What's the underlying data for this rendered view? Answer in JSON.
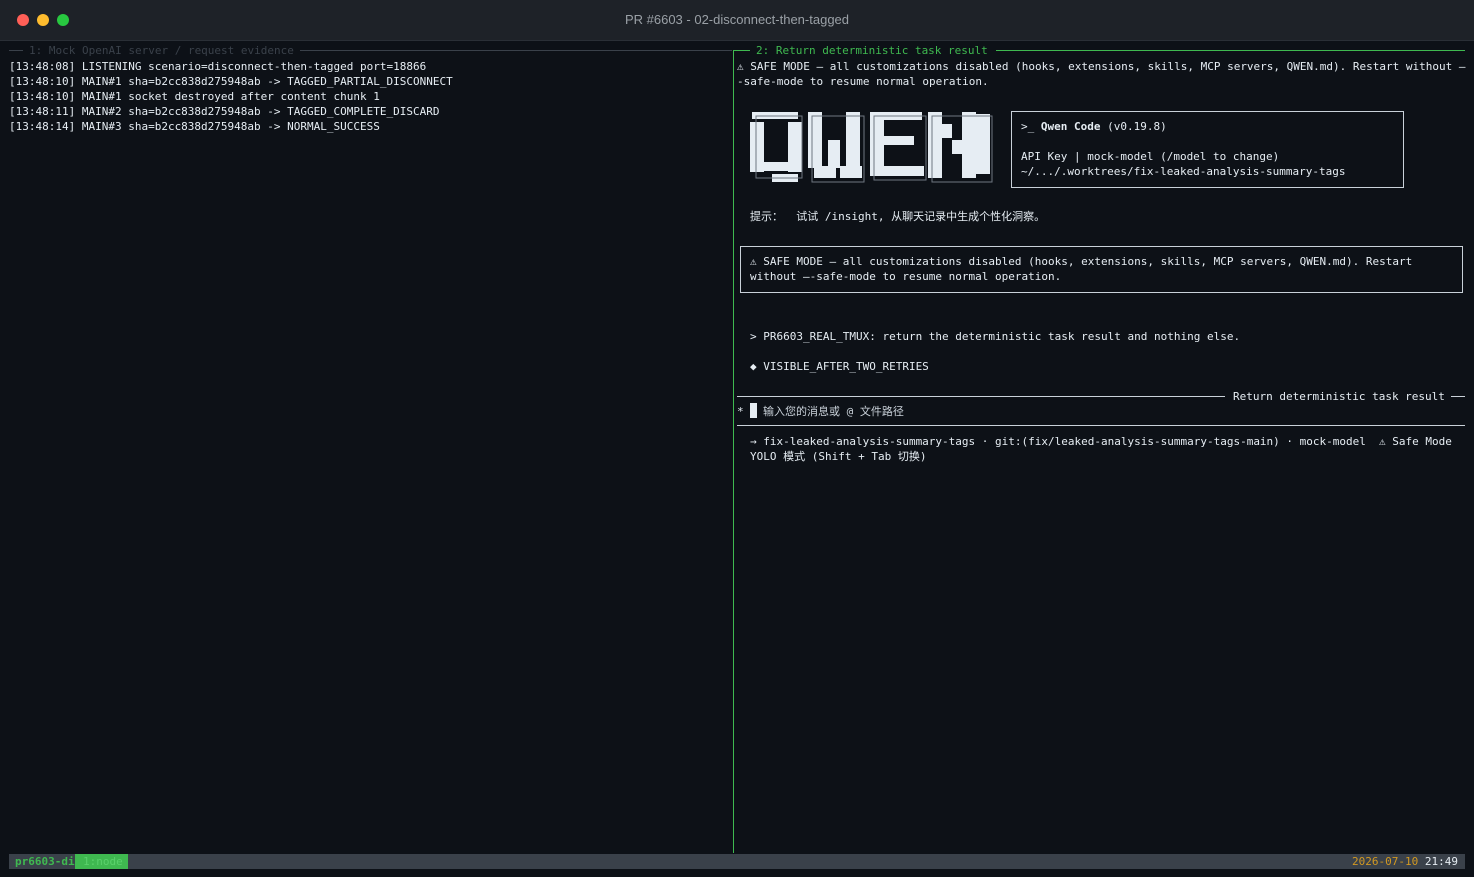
{
  "window": {
    "title": "PR #6603 - 02-disconnect-then-tagged"
  },
  "left_pane": {
    "header": "1: Mock OpenAI server / request evidence",
    "lines": [
      "[13:48:08] LISTENING scenario=disconnect-then-tagged port=18866",
      "[13:48:10] MAIN#1 sha=b2cc838d275948ab -> TAGGED_PARTIAL_DISCONNECT",
      "[13:48:10] MAIN#1 socket destroyed after content chunk 1",
      "[13:48:11] MAIN#2 sha=b2cc838d275948ab -> TAGGED_COMPLETE_DISCARD",
      "[13:48:14] MAIN#3 sha=b2cc838d275948ab -> NORMAL_SUCCESS"
    ]
  },
  "right_pane": {
    "header": "2: Return deterministic task result",
    "warning_line1": "⚠ SAFE MODE — all customizations disabled (hooks, extensions, skills, MCP servers, QWEN.md). Restart without –",
    "warning_line2": "-safe-mode to resume normal operation.",
    "info_box": {
      "prompt": ">_",
      "app_name": "Qwen Code",
      "version": "(v0.19.8)",
      "auth_line": "API Key | mock-model (/model to change)",
      "path": "~/.../.worktrees/fix-leaked-analysis-summary-tags"
    },
    "tip": "提示：  试试 /insight, 从聊天记录中生成个性化洞察。",
    "safe_box_line1": "⚠ SAFE MODE — all customizations disabled (hooks, extensions, skills, MCP servers, QWEN.md). Restart",
    "safe_box_line2": "without —-safe-mode to resume normal operation.",
    "user_prompt": "> PR6603_REAL_TMUX: return the deterministic task result and nothing else.",
    "response": "◆ VISIBLE_AFTER_TWO_RETRIES",
    "input_title": "Return deterministic task result",
    "input_prefix": "*",
    "input_placeholder": "输入您的消息或 @ 文件路径",
    "footer_line1_left": "→ fix-leaked-analysis-summary-tags · git:(fix/leaked-analysis-summary-tags-main) · mock-model",
    "footer_line1_right": "⚠ Safe Mode",
    "footer_line2": "YOLO 模式 (Shift + Tab 切换)"
  },
  "status_bar": {
    "session": "pr6603-di",
    "window": "1:node",
    "date": "2026-07-10",
    "time": "21:49"
  },
  "colors": {
    "accent_green": "#3fb950",
    "warning_yellow": "#d29922",
    "background": "#0d1117",
    "text": "#e6edf3"
  }
}
